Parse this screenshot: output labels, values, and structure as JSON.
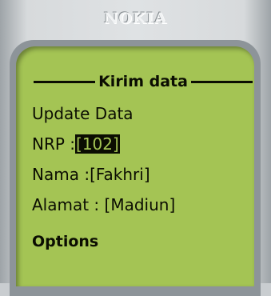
{
  "brand": "NOKIA",
  "screen": {
    "title": "Kirim data",
    "items": [
      {
        "label": "Update Data"
      },
      {
        "label": "NRP :",
        "value": "[102]",
        "selected": true
      },
      {
        "label": "Nama :",
        "value": "[Fakhri]"
      },
      {
        "label": "Alamat : ",
        "value": "[Madiun]"
      }
    ],
    "softkey": "Options"
  },
  "colors": {
    "lcd_background": "#a4c454",
    "lcd_text": "#0b0d02",
    "bezel": "#8d9499"
  }
}
